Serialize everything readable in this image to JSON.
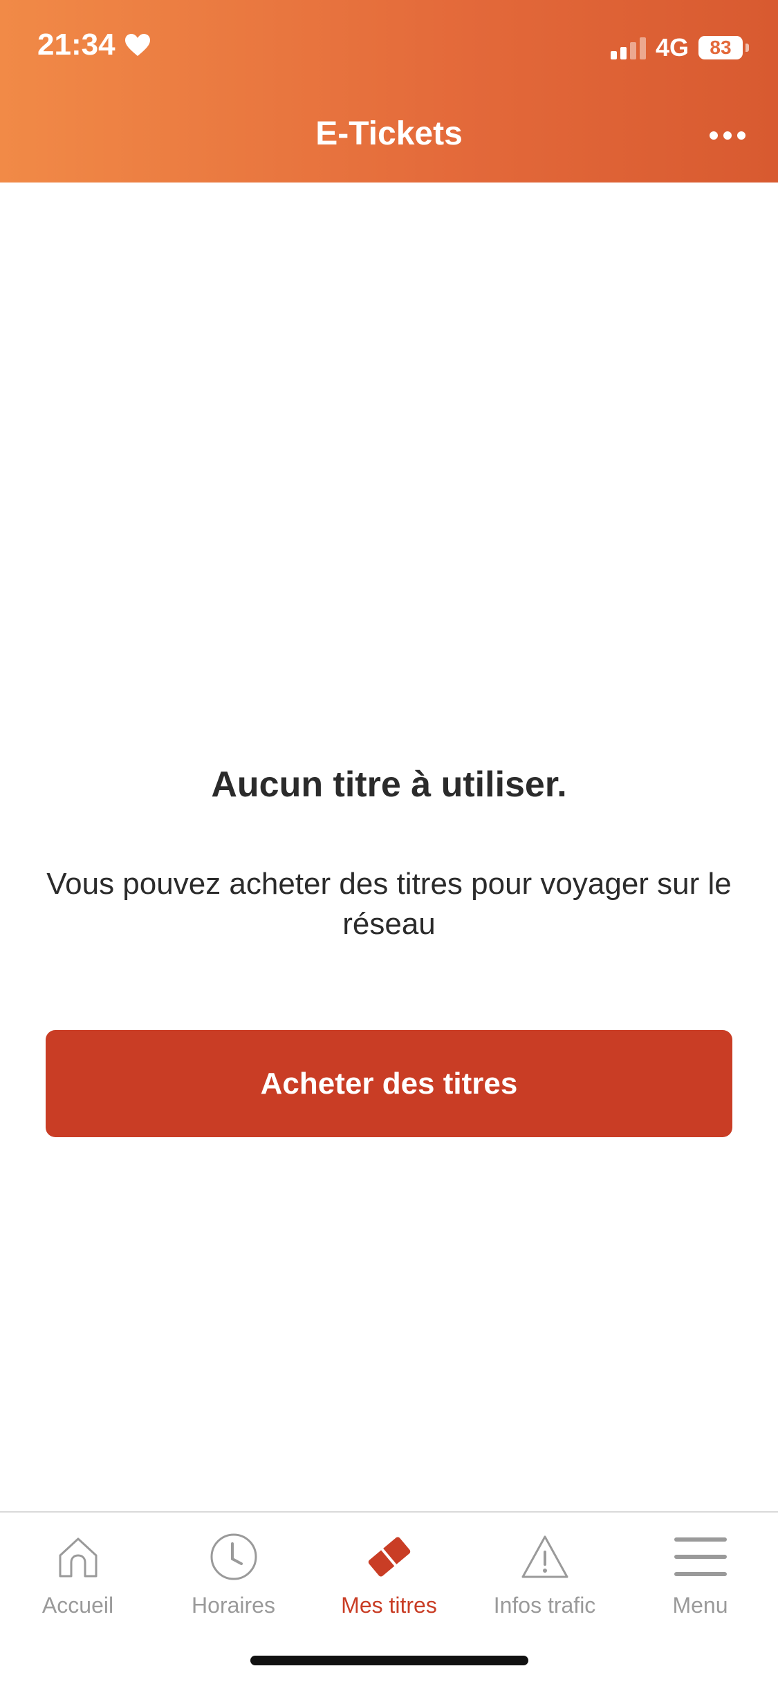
{
  "status_bar": {
    "time": "21:34",
    "network": "4G",
    "battery": "83"
  },
  "nav": {
    "title": "E-Tickets"
  },
  "empty_state": {
    "title": "Aucun titre à utiliser.",
    "text": "Vous pouvez acheter des titres pour voyager sur le réseau",
    "button_label": "Acheter des titres"
  },
  "tabs": [
    {
      "label": "Accueil",
      "icon": "home-icon",
      "active": false
    },
    {
      "label": "Horaires",
      "icon": "clock-icon",
      "active": false
    },
    {
      "label": "Mes titres",
      "icon": "ticket-icon",
      "active": true
    },
    {
      "label": "Infos trafic",
      "icon": "warning-icon",
      "active": false
    },
    {
      "label": "Menu",
      "icon": "menu-icon",
      "active": false
    }
  ],
  "colors": {
    "header_start": "#f18a47",
    "header_end": "#d85a30",
    "accent": "#c93d25",
    "inactive_tab": "#9a9a9a"
  }
}
